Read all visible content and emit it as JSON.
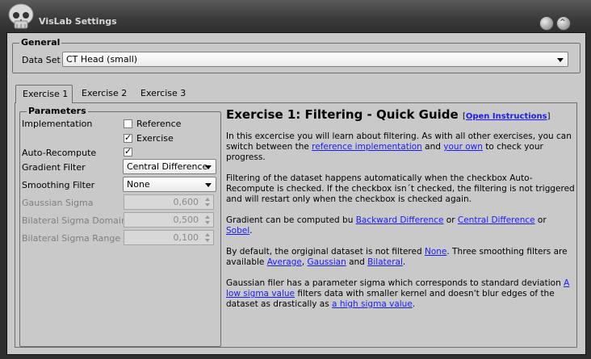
{
  "window": {
    "title": "VisLab Settings",
    "close_glyph": "^"
  },
  "general": {
    "legend": "General",
    "dataset_label": "Data Set",
    "dataset_value": "CT Head (small)"
  },
  "tabs": [
    {
      "label": "Exercise 1",
      "active": true
    },
    {
      "label": "Exercise 2",
      "active": false
    },
    {
      "label": "Exercise 3",
      "active": false
    }
  ],
  "parameters": {
    "legend": "Parameters",
    "implementation_label": "Implementation",
    "reference_label": "Reference",
    "reference_checked": false,
    "exercise_label": "Exercise",
    "exercise_checked": true,
    "autorecompute_label": "Auto-Recompute",
    "autorecompute_checked": true,
    "gradient_label": "Gradient Filter",
    "gradient_value": "Central Difference",
    "smoothing_label": "Smoothing Filter",
    "smoothing_value": "None",
    "gaussian_sigma_label": "Gaussian Sigma",
    "gaussian_sigma_value": "0,600",
    "bilateral_domain_label": "Bilateral Sigma Domain",
    "bilateral_domain_value": "0,500",
    "bilateral_range_label": "Bilateral Sigma Range",
    "bilateral_range_value": "0,100"
  },
  "guide": {
    "title": "Exercise 1: Filtering - Quick Guide",
    "open_bracket": "[",
    "open_link": "Open Instructions",
    "close_bracket": "]",
    "p1_a": "In this excercise you will learn about filtering. As with all other exercises, you can switch between the ",
    "p1_link1": "reference implementation",
    "p1_b": " and ",
    "p1_link2": "your own",
    "p1_c": " to check your progress.",
    "p2": "Filtering of the dataset happens automatically when the checkbox Auto-Recompute is checked. If the checkbox isn´t checked, the filtering is not triggered and will restart only when the checkbox is checked again.",
    "p3_a": "Gradient can be computed bu ",
    "p3_link1": "Backward Difference",
    "p3_b": " or ",
    "p3_link2": "Central Difference",
    "p3_c": " or ",
    "p3_link3": "Sobel",
    "p3_d": ".",
    "p4_a": "By default, the orgiginal dataset is not filtered ",
    "p4_link1": "None",
    "p4_b": ". Three smoothing filters are available ",
    "p4_link2": "Average",
    "p4_c": ", ",
    "p4_link3": "Gaussian",
    "p4_d": " and ",
    "p4_link4": "Bilateral",
    "p4_e": ".",
    "p5_a": "Gaussian filer has a parameter sigma which corresponds to standard deviation ",
    "p5_link1": "A low sigma value",
    "p5_b": " filters data with smaller kernel and doesn't blur edges of the dataset as drastically as ",
    "p5_link2": "a high sigma value",
    "p5_c": "."
  }
}
